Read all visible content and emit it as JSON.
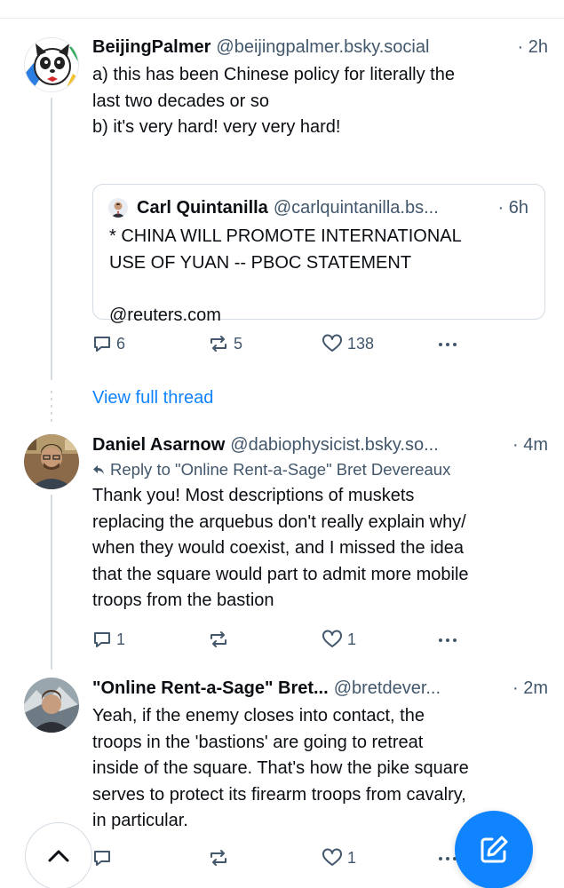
{
  "posts": [
    {
      "author": "BeijingPalmer",
      "handle": "@beijingpalmer.bsky.social",
      "time": "· 2h",
      "body": [
        "a) this has been Chinese policy for literally the",
        "last two decades or so",
        "b) it's very hard! very very hard!"
      ],
      "quote": {
        "author": "Carl Quintanilla",
        "handle": "@carlquintanilla.bs...",
        "time": "· 6h",
        "body": [
          "* CHINA WILL PROMOTE INTERNATIONAL",
          "USE OF YUAN -- PBOC STATEMENT",
          "",
          "@reuters.com"
        ]
      },
      "replies": "6",
      "reposts": "5",
      "likes": "138"
    },
    {
      "author": "Daniel Asarnow",
      "handle": "@dabiophysicist.bsky.so...",
      "time": "· 4m",
      "reply_to": "Reply to \"Online Rent-a-Sage\" Bret Devereaux",
      "body": [
        "Thank you! Most descriptions of muskets",
        "replacing the arquebus don't really explain why/",
        "when they would coexist, and I missed the idea",
        "that the square would part to admit more mobile",
        "troops from the bastion"
      ],
      "replies": "1",
      "reposts": "",
      "likes": "1"
    },
    {
      "author": "\"Online Rent-a-Sage\" Bret...",
      "handle": "@bretdever...",
      "time": "· 2m",
      "body": [
        "Yeah, if the enemy closes into contact, the",
        "troops in the 'bastions' are going to retreat",
        "inside of the square.  That's how the pike square",
        "serves to protect its firearm troops from cavalry,",
        "in particular."
      ],
      "replies": "",
      "reposts": "",
      "likes": "1"
    }
  ],
  "view_full_thread": "View full thread",
  "icons": {
    "reply": "reply-icon",
    "repost": "repost-icon",
    "like": "heart-icon",
    "more": "more-dots-icon",
    "compose": "compose-icon",
    "scroll_top": "chevron-up-icon"
  },
  "colors": {
    "link": "#1083fe",
    "muted": "#42576c",
    "border": "#d4dbe2"
  }
}
